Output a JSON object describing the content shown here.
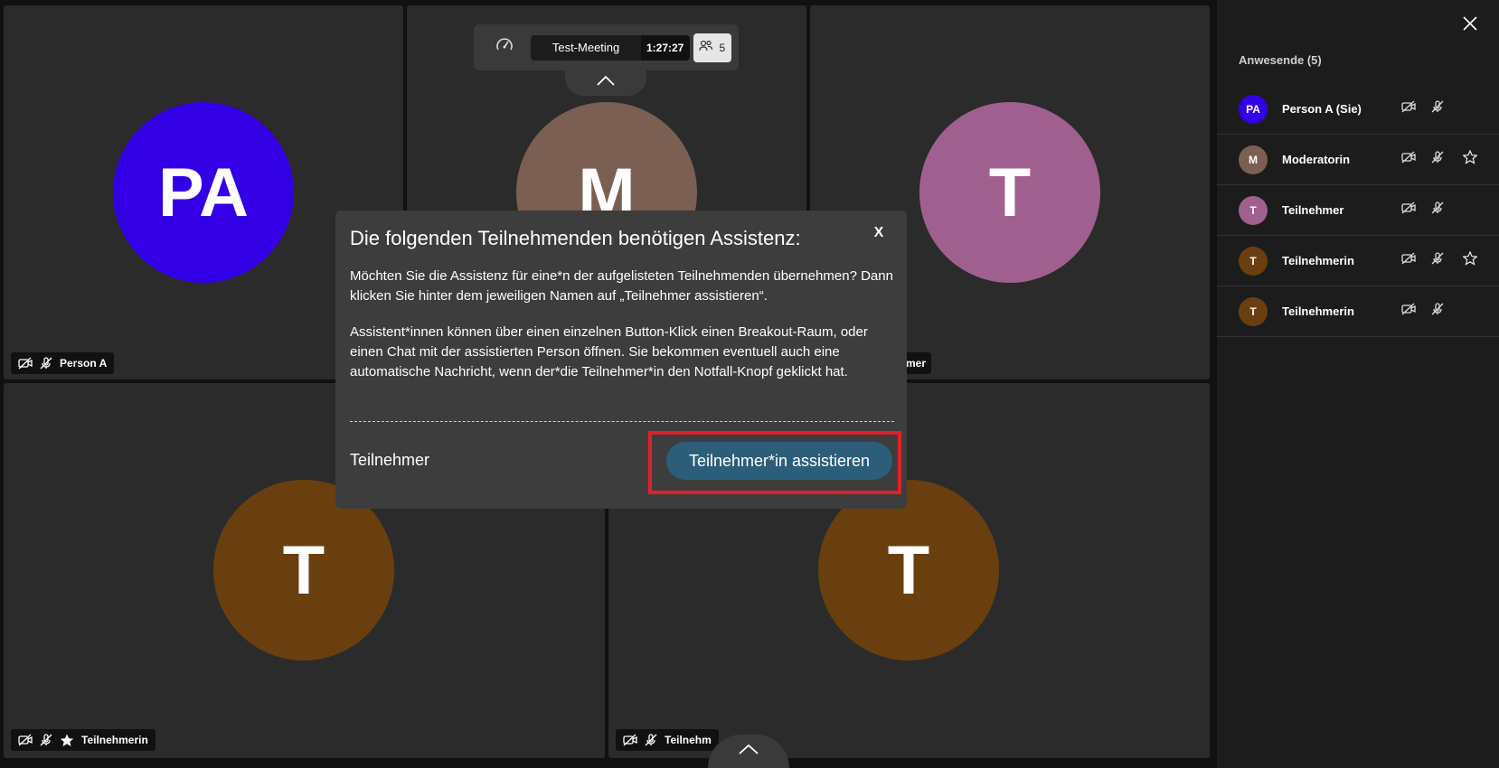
{
  "meeting": {
    "title": "Test-Meeting",
    "elapsed": "1:27:27",
    "participant_count": "5"
  },
  "tiles": [
    {
      "initials": "PA",
      "color": "#3300e6",
      "name": "Person A",
      "has_star": false
    },
    {
      "initials": "M",
      "color": "#7b5f52",
      "name": "Moderatorin",
      "has_star": true
    },
    {
      "initials": "T",
      "color": "#a0608f",
      "name": "Teilnehmer",
      "has_star": false
    },
    {
      "initials": "T",
      "color": "#6a3f10",
      "name": "Teilnehmerin",
      "has_star": true
    },
    {
      "initials": "T",
      "color": "#6a3f10",
      "name": "Teilnehmerin",
      "has_star": false
    }
  ],
  "tile_name_visible": {
    "tile3": "mer",
    "tile5": "Teilnehm"
  },
  "sidebar": {
    "heading": "Anwesende (5)",
    "participants": [
      {
        "initials": "PA",
        "color": "#3300e6",
        "name": "Person A (Sie)",
        "star": false
      },
      {
        "initials": "M",
        "color": "#7b5f52",
        "name": "Moderatorin",
        "star": true
      },
      {
        "initials": "T",
        "color": "#a0608f",
        "name": "Teilnehmer",
        "star": false
      },
      {
        "initials": "T",
        "color": "#6a3f10",
        "name": "Teilnehmerin",
        "star": true
      },
      {
        "initials": "T",
        "color": "#6a3f10",
        "name": "Teilnehmerin",
        "star": false
      }
    ]
  },
  "modal": {
    "title": "Die folgenden Teilnehmenden benötigen Assistenz:",
    "close_label": "X",
    "paragraph1": "Möchten Sie die Assistenz für eine*n der aufgelisteten Teilnehmenden übernehmen? Dann klicken Sie hinter dem jeweiligen Namen auf „Teilnehmer assistieren“.",
    "paragraph2": "Assistent*innen können über einen einzelnen Button-Klick einen Breakout-Raum, oder einen Chat mit der assistierten Person öffnen. Sie bekommen eventuell auch eine automatische Nachricht, wenn der*die Teilnehmer*in den Notfall-Knopf geklickt hat.",
    "participant_name": "Teilnehmer",
    "assist_button": "Teilnehmer*in assistieren"
  },
  "colors": {
    "accent_button": "#2c5e7a",
    "highlight_outline": "#e0202a"
  }
}
